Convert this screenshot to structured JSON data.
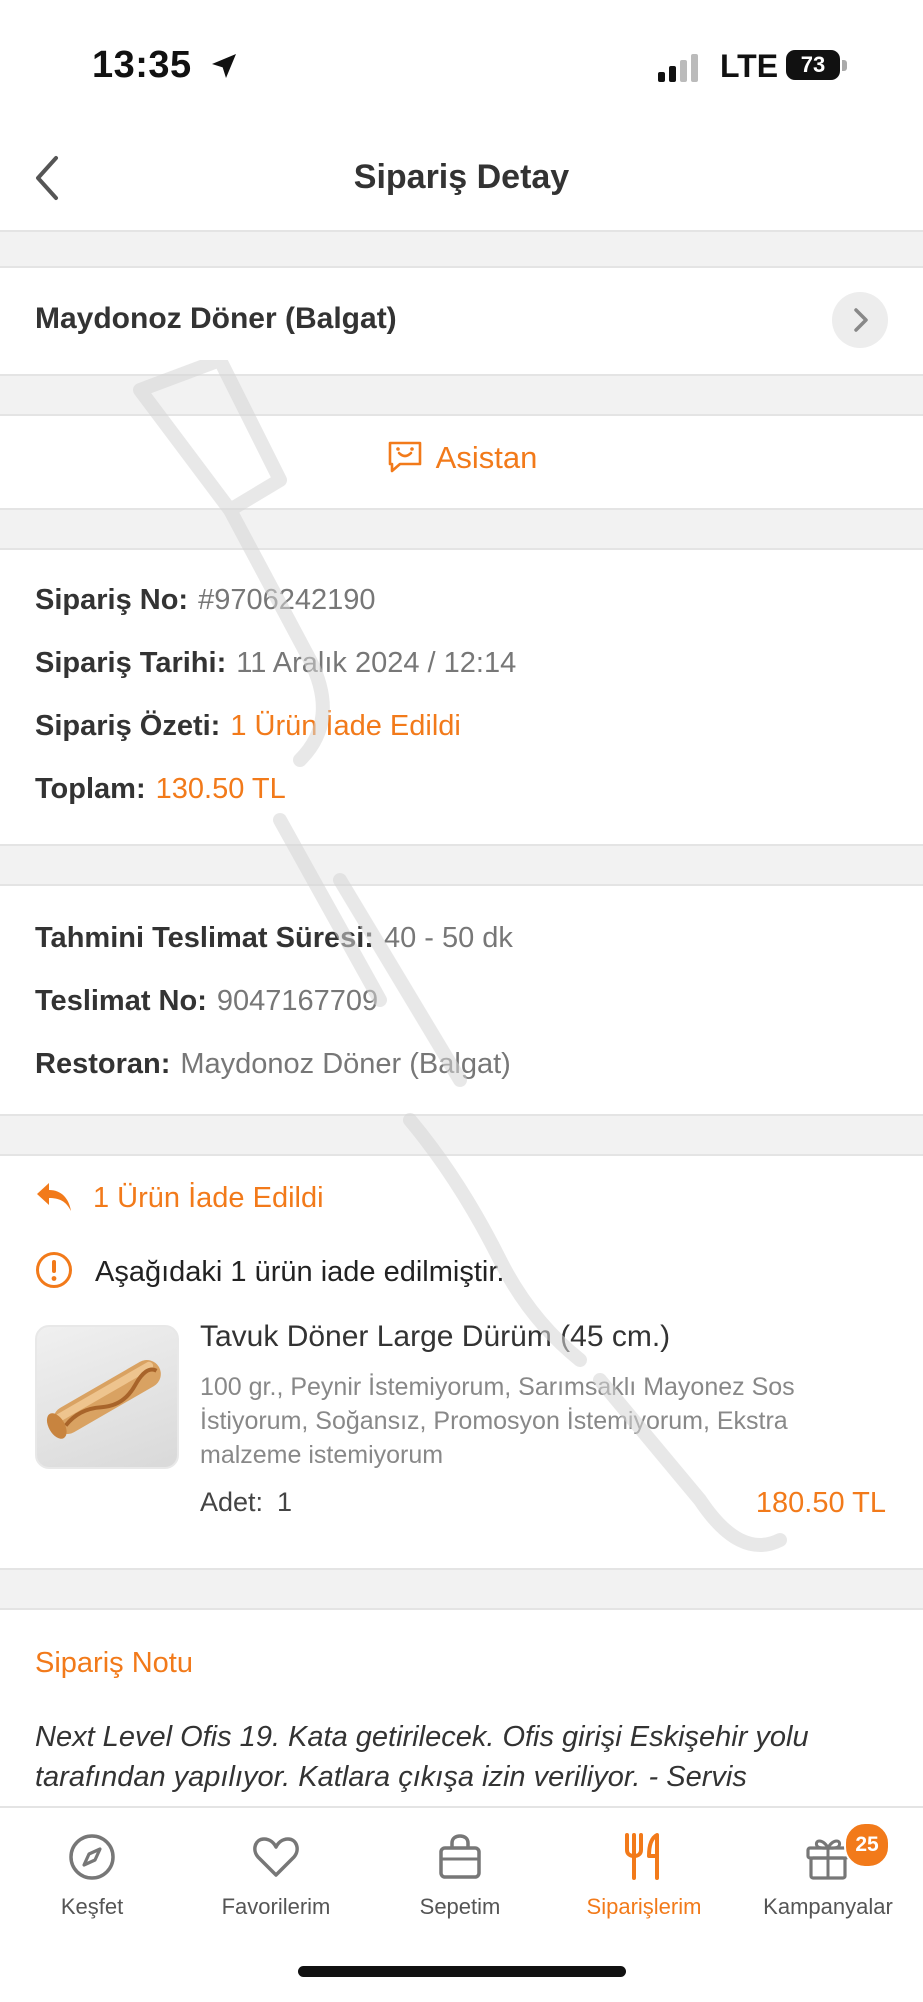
{
  "status_bar": {
    "time": "13:35",
    "network": "LTE",
    "battery": "73"
  },
  "header": {
    "title": "Sipariş Detay"
  },
  "restaurant": {
    "name": "Maydonoz Döner (Balgat)"
  },
  "assistant": {
    "label": "Asistan"
  },
  "order_info": {
    "order_no_label": "Sipariş No:",
    "order_no": "#9706242190",
    "date_label": "Sipariş Tarihi:",
    "date": "11 Aralık 2024 / 12:14",
    "summary_label": "Sipariş Özeti:",
    "summary": "1 Ürün İade Edildi",
    "total_label": "Toplam:",
    "total": "130.50 TL"
  },
  "delivery_info": {
    "eta_label": "Tahmini Teslimat Süresi:",
    "eta": "40 - 50 dk",
    "delivery_no_label": "Teslimat No:",
    "delivery_no": "9047167709",
    "restaurant_label": "Restoran:",
    "restaurant": "Maydonoz Döner (Balgat)"
  },
  "refund": {
    "heading": "1 Ürün İade Edildi",
    "notice": "Aşağıdaki 1 ürün iade edilmiştir.",
    "product": {
      "name": "Tavuk Döner Large Dürüm (45 cm.)",
      "description": "100 gr., Peynir İstemiyorum, Sarımsaklı Mayonez Sos İstiyorum, Soğansız, Promosyon İstemiyorum, Ekstra malzeme istemiyorum",
      "qty_label": "Adet:",
      "qty": "1",
      "price": "180.50 TL"
    }
  },
  "order_note": {
    "title": "Sipariş Notu",
    "text": "Next Level Ofis 19. Kata getirilecek. Ofis girişi Eskişehir yolu tarafından yapılıyor. Katlara çıkışa izin veriliyor. - Servis"
  },
  "tabs": [
    {
      "label": "Keşfet",
      "icon": "compass-icon"
    },
    {
      "label": "Favorilerim",
      "icon": "heart-icon"
    },
    {
      "label": "Sepetim",
      "icon": "bag-icon"
    },
    {
      "label": "Siparişlerim",
      "icon": "fork-knife-icon",
      "active": true
    },
    {
      "label": "Kampanyalar",
      "icon": "gift-icon",
      "badge": "25"
    }
  ],
  "colors": {
    "accent": "#f27a1a",
    "divider": "#f2f2f2"
  }
}
